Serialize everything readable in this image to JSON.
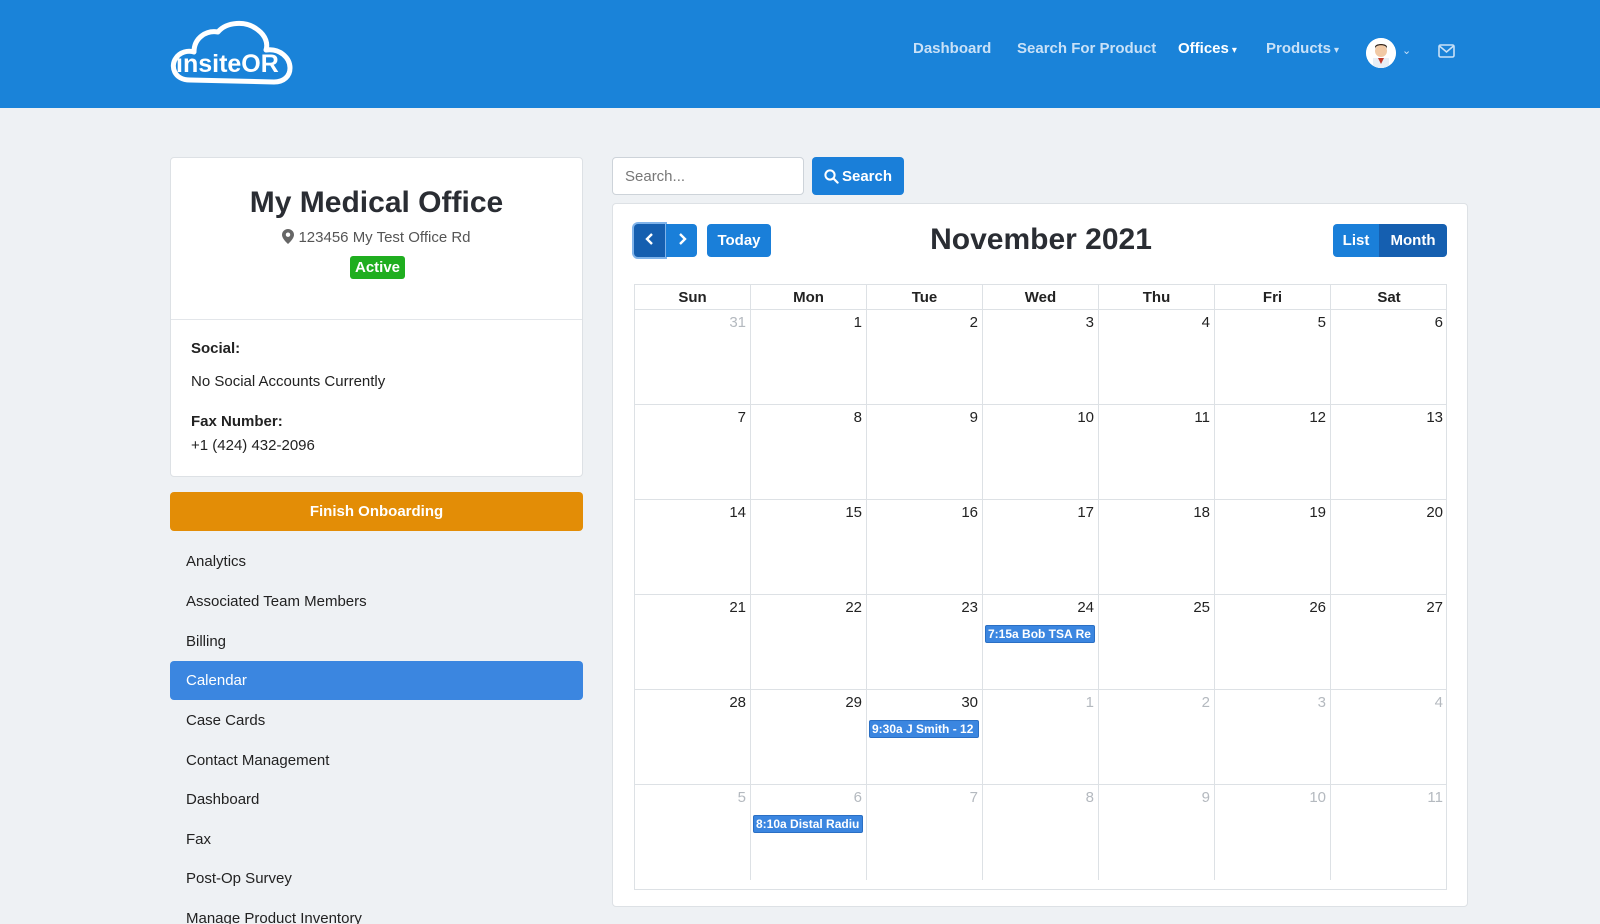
{
  "header": {
    "logo_text": "insiteOR",
    "nav": [
      {
        "label": "Dashboard",
        "active": false
      },
      {
        "label": "Search For Product",
        "active": false
      },
      {
        "label": "Offices",
        "active": true,
        "dropdown": true
      },
      {
        "label": "Products",
        "active": false,
        "dropdown": true
      }
    ],
    "icons": {
      "avatar": "user-avatar",
      "avatar_menu": "chevron-down-icon",
      "mail": "envelope-icon"
    },
    "colors": {
      "bar": "#1a83d9"
    }
  },
  "office": {
    "name": "My Medical Office",
    "address": "123456 My Test Office Rd",
    "status": "Active",
    "social_label": "Social:",
    "social_value": "No Social Accounts Currently",
    "fax_label": "Fax Number:",
    "fax_value": "+1 (424) 432-2096"
  },
  "sidebar": {
    "onboarding_button": "Finish Onboarding",
    "items": [
      {
        "label": "Analytics",
        "active": false
      },
      {
        "label": "Associated Team Members",
        "active": false
      },
      {
        "label": "Billing",
        "active": false
      },
      {
        "label": "Calendar",
        "active": true
      },
      {
        "label": "Case Cards",
        "active": false
      },
      {
        "label": "Contact Management",
        "active": false
      },
      {
        "label": "Dashboard",
        "active": false
      },
      {
        "label": "Fax",
        "active": false
      },
      {
        "label": "Post-Op Survey",
        "active": false
      },
      {
        "label": "Manage Product Inventory",
        "active": false
      }
    ]
  },
  "search": {
    "placeholder": "Search...",
    "value": "",
    "button_label": "Search"
  },
  "calendar": {
    "title": "November 2021",
    "today_label": "Today",
    "views": [
      "List",
      "Month"
    ],
    "active_view": "Month",
    "weekdays": [
      "Sun",
      "Mon",
      "Tue",
      "Wed",
      "Thu",
      "Fri",
      "Sat"
    ],
    "weeks": [
      [
        {
          "d": "31",
          "other": true
        },
        {
          "d": "1"
        },
        {
          "d": "2"
        },
        {
          "d": "3"
        },
        {
          "d": "4"
        },
        {
          "d": "5"
        },
        {
          "d": "6"
        }
      ],
      [
        {
          "d": "7"
        },
        {
          "d": "8"
        },
        {
          "d": "9"
        },
        {
          "d": "10"
        },
        {
          "d": "11"
        },
        {
          "d": "12"
        },
        {
          "d": "13"
        }
      ],
      [
        {
          "d": "14"
        },
        {
          "d": "15"
        },
        {
          "d": "16"
        },
        {
          "d": "17"
        },
        {
          "d": "18"
        },
        {
          "d": "19"
        },
        {
          "d": "20"
        }
      ],
      [
        {
          "d": "21"
        },
        {
          "d": "22"
        },
        {
          "d": "23"
        },
        {
          "d": "24",
          "event": "7:15a Bob TSA Re"
        },
        {
          "d": "25"
        },
        {
          "d": "26"
        },
        {
          "d": "27"
        }
      ],
      [
        {
          "d": "28"
        },
        {
          "d": "29"
        },
        {
          "d": "30",
          "event": "9:30a J Smith - 12"
        },
        {
          "d": "1",
          "other": true
        },
        {
          "d": "2",
          "other": true
        },
        {
          "d": "3",
          "other": true
        },
        {
          "d": "4",
          "other": true
        }
      ],
      [
        {
          "d": "5",
          "other": true
        },
        {
          "d": "6",
          "other": true,
          "event": "8:10a Distal Radiu"
        },
        {
          "d": "7",
          "other": true
        },
        {
          "d": "8",
          "other": true
        },
        {
          "d": "9",
          "other": true
        },
        {
          "d": "10",
          "other": true
        },
        {
          "d": "11",
          "other": true
        }
      ]
    ],
    "colors": {
      "event": "#3b86e0",
      "button": "#1a7fd9"
    }
  }
}
